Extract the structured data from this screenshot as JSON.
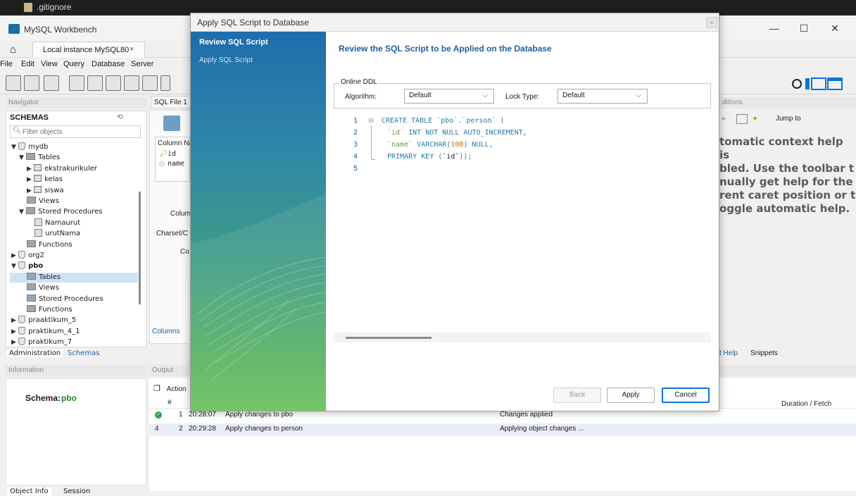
{
  "top_strip": {
    "file_name": ".gitignore"
  },
  "app": {
    "title": "MySQL Workbench",
    "tab": "Local instance MySQL80",
    "tab_close": "×",
    "home_icon": "⌂",
    "win_min": "—",
    "win_max": "☐",
    "win_close": "✕"
  },
  "menu": [
    "File",
    "Edit",
    "View",
    "Query",
    "Database",
    "Server"
  ],
  "navigator": {
    "header": "Navigator",
    "schemas_title": "SCHEMAS",
    "filter_placeholder": "Filter objects",
    "tree": [
      {
        "label": "mydb",
        "type": "db",
        "depth": 0,
        "open": true
      },
      {
        "label": "Tables",
        "type": "folder",
        "depth": 1,
        "open": true
      },
      {
        "label": "ekstrakurikuler",
        "type": "table",
        "depth": 2,
        "open": false
      },
      {
        "label": "kelas",
        "type": "table",
        "depth": 2,
        "open": false
      },
      {
        "label": "siswa",
        "type": "table",
        "depth": 2,
        "open": false
      },
      {
        "label": "Views",
        "type": "folder",
        "depth": 1
      },
      {
        "label": "Stored Procedures",
        "type": "folder",
        "depth": 1,
        "open": true
      },
      {
        "label": "Namaurut",
        "type": "proc",
        "depth": 2
      },
      {
        "label": "urutNama",
        "type": "proc",
        "depth": 2
      },
      {
        "label": "Functions",
        "type": "folder",
        "depth": 1
      },
      {
        "label": "org2",
        "type": "db",
        "depth": 0,
        "open": false
      },
      {
        "label": "pbo",
        "type": "db",
        "depth": 0,
        "open": true,
        "bold": true
      },
      {
        "label": "Tables",
        "type": "folder",
        "depth": 1,
        "selected": true
      },
      {
        "label": "Views",
        "type": "folder",
        "depth": 1
      },
      {
        "label": "Stored Procedures",
        "type": "folder",
        "depth": 1
      },
      {
        "label": "Functions",
        "type": "folder",
        "depth": 1
      },
      {
        "label": "praaktikum_5",
        "type": "db",
        "depth": 0,
        "open": false
      },
      {
        "label": "praktikum_4_1",
        "type": "db",
        "depth": 0,
        "open": false
      },
      {
        "label": "praktikum_7",
        "type": "db",
        "depth": 0,
        "open": false
      }
    ],
    "tabs": [
      "Administration",
      "Schemas"
    ]
  },
  "info": {
    "header": "Information",
    "schema_label": "Schema:",
    "schema_value": "pbo",
    "tabs": [
      "Object Info",
      "Session"
    ]
  },
  "editor": {
    "tab": "SQL File 1",
    "col_header": "Column Na",
    "col_id": "id",
    "col_name": "name",
    "label_column": "Colum",
    "label_charset": "Charset/C",
    "label_co": "Co",
    "columns_tab": "Columns"
  },
  "output": {
    "header": "Output",
    "action_label": "Action",
    "hash": "#",
    "duration_header": "Duration / Fetch",
    "rows": [
      {
        "status": "ok",
        "num": "1",
        "time": "20:28:07",
        "action": "Apply changes to pbo",
        "message": "Changes applied"
      },
      {
        "status": "4",
        "num": "2",
        "time": "20:29:28",
        "action": "Apply changes to person",
        "message": "Applying object changes ..."
      }
    ]
  },
  "context_help": {
    "header": "ditions",
    "jump_to": "Jump to",
    "text_lines": [
      "tomatic context help is",
      "bled. Use the toolbar t",
      "nually get help for the",
      "rent caret position or t",
      "oggle automatic help."
    ],
    "tabs": [
      "t Help",
      "Snippets"
    ]
  },
  "dialog": {
    "title": "Apply SQL Script to Database",
    "close": "×",
    "steps": [
      "Review SQL Script",
      "Apply SQL Script"
    ],
    "heading": "Review the SQL Script to be Applied on the Database",
    "online_ddl": "Online DDL",
    "algorithm_label": "Algorithm:",
    "algorithm_value": "Default",
    "lock_label": "Lock Type:",
    "lock_value": "Default",
    "line_numbers": [
      "1",
      "2",
      "3",
      "4",
      "5"
    ],
    "buttons": {
      "back": "Back",
      "apply": "Apply",
      "cancel": "Cancel"
    }
  },
  "colors": {
    "accent_blue": "#1f5f9e",
    "green": "#1c8a1c",
    "keyword": "#2a7aa3",
    "string": "#6a9a48",
    "number": "#c26a12"
  }
}
